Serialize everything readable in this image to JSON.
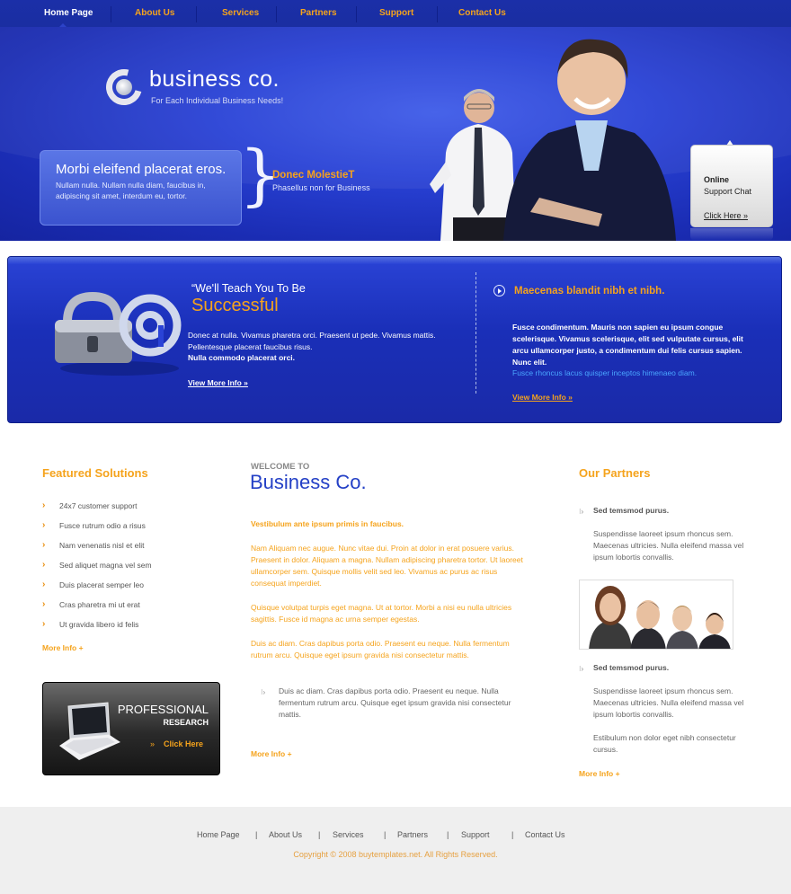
{
  "nav": {
    "items": [
      "Home Page",
      "About Us",
      "Services",
      "Partners",
      "Support",
      "Contact Us"
    ],
    "active": "Home Page"
  },
  "header": {
    "logo_title": "business co.",
    "logo_tagline": "For Each Individual Business Needs!",
    "box_title": "Morbi eleifend placerat eros.",
    "box_body": "Nullam nulla. Nullam nulla diam, faucibus in, adipiscing sit amet, interdum eu, tortor.",
    "donec_title": "Donec MolestieT",
    "donec_sub": "Phasellus non for Business",
    "chat_online": "Online",
    "chat_support": "Support Chat",
    "chat_link": "Click Here »"
  },
  "banner": {
    "quote": "“We'll Teach You To Be",
    "big": "Successful",
    "body": "Donec at nulla. Vivamus pharetra orci. Praesent ut pede. Vivamus mattis. Pellentesque placerat faucibus risus.",
    "bold": "Nulla commodo placerat orci.",
    "view_more_1": "View More Info »",
    "right_title": "Maecenas blandit nibh et nibh.",
    "right_body": "Fusce condimentum. Mauris non sapien eu ipsum congue scelerisque. Vivamus scelerisque, elit sed vulputate cursus, elit arcu ullamcorper justo, a condimentum dui felis cursus sapien. Nunc elit.",
    "right_blue": "Fusce rhoncus lacus quisper inceptos himenaeo diam.",
    "view_more_2": "View More Info »"
  },
  "featured": {
    "title": "Featured Solutions",
    "items": [
      "24x7 customer support",
      "Fusce rutrum odio a risus",
      "Nam venenatis nisl et elit",
      "Sed aliquet magna vel sem",
      "Duis placerat semper leo",
      "Cras pharetra mi ut erat",
      "Ut gravida libero id felis"
    ],
    "more": "More Info +",
    "promo_line1": "PROFESSIONAL",
    "promo_line2": "RESEARCH",
    "promo_click": "Click Here"
  },
  "center": {
    "welcome": "WELCOME TO",
    "title": "Business Co.",
    "lead": "Vestibulum ante ipsum primis in faucibus.",
    "para1": "Nam Aliquam nec augue. Nunc vitae dui. Proin at dolor in erat posuere varius. Praesent in dolor. Aliquam a magna. Nullam adipiscing pharetra tortor. Ut laoreet ullamcorper sem. Quisque mollis velit sed leo. Vivamus ac purus ac risus consequat imperdiet.",
    "para2": "Quisque volutpat turpis eget magna. Ut at tortor. Morbi a nisi eu nulla ultricies sagittis. Fusce id magna ac urna semper egestas.",
    "para3": "Duis ac diam. Cras dapibus porta odio. Praesent eu neque. Nulla fermentum rutrum arcu. Quisque eget ipsum gravida nisi consectetur mattis.",
    "quote": "Duis ac diam. Cras dapibus porta odio. Praesent eu neque. Nulla fermentum rutrum arcu. Quisque eget ipsum gravida nisi consectetur mattis.",
    "more": "More Info +"
  },
  "partners": {
    "title": "Our Partners",
    "head1": "Sed temsmod purus.",
    "text1": "Suspendisse laoreet ipsum rhoncus sem. Maecenas ultricies. Nulla eleifend massa vel ipsum lobortis convallis.",
    "head2": "Sed temsmod purus.",
    "text2": "Suspendisse laoreet ipsum rhoncus sem. Maecenas ultricies. Nulla eleifend massa vel ipsum lobortis convallis.",
    "text3": "Estibulum non dolor eget nibh consectetur cursus.",
    "more": "More Info +"
  },
  "footer": {
    "links": [
      "Home Page",
      "About Us",
      "Services",
      "Partners",
      "Support",
      "Contact Us"
    ],
    "separator": "|",
    "copyright": "Copyright © 2008 buytemplates.net. All Rights Reserved."
  },
  "colors": {
    "nav_bg": "#1b2fa8",
    "accent_orange": "#f5a31c",
    "title_blue": "#2440c6",
    "footer_bg": "#efefef"
  }
}
